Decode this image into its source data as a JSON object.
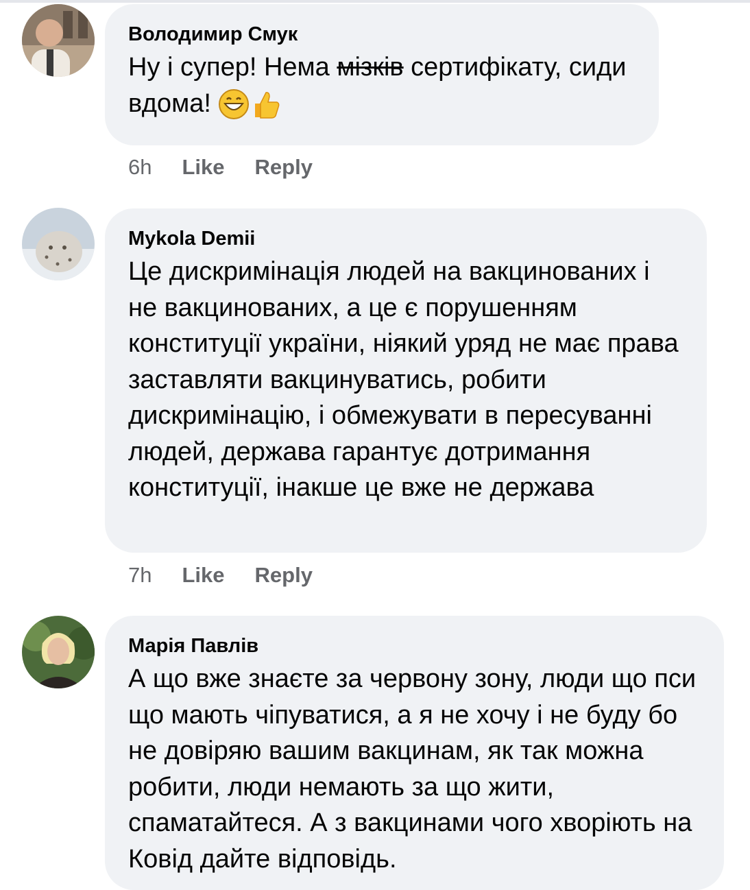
{
  "comments": [
    {
      "author": "Володимир Смук",
      "text_before": "Ну і супер! Нема ",
      "text_struck": "мізків",
      "text_after": " сертифікату, сиди вдома! ",
      "emojis": [
        "grinning-face-icon",
        "thumbs-up-icon"
      ],
      "time": "6h",
      "like": "Like",
      "reply": "Reply"
    },
    {
      "author": "Mykola Demii",
      "text": "Це дискримінація людей на вакцинованих і не вакцинованих, а це є порушенням конституції україни, ніякий уряд не має права заставляти вакцинуватись, робити дискримінацію, і обмежувати в пересуванні людей, держава гарантує дотримання конституції, інакше це вже не держава",
      "time": "7h",
      "like": "Like",
      "reply": "Reply"
    },
    {
      "author": "Марія Павлів",
      "text": "А що вже знаєте за червону зону, люди що пси що мають чіпуватися, а я не хочу і не буду бо не довіряю вашим вакцинам, як так можна робити, люди немають за що жити, спаматайтеся. А з вакцинами чого хворіють на Ковід дайте відповідь."
    }
  ]
}
